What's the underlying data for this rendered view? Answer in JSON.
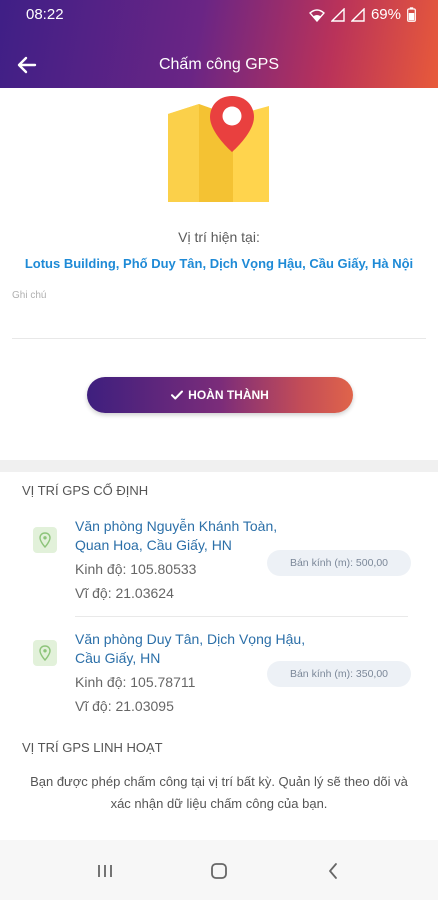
{
  "status_bar": {
    "time": "08:22",
    "battery": "69%"
  },
  "header": {
    "title": "Chấm công GPS"
  },
  "location": {
    "label": "Vị trí hiện tại:",
    "address": "Lotus Building, Phố Duy Tân, Dịch Vọng Hậu, Cầu Giấy, Hà Nội"
  },
  "note": {
    "placeholder": "Ghi chú"
  },
  "complete_button": {
    "label": "HOÀN THÀNH"
  },
  "fixed_section": {
    "title": "VỊ TRÍ GPS CỐ ĐỊNH",
    "items": [
      {
        "name": "Văn phòng Nguyễn Khánh Toàn, Quan Hoa, Cầu Giấy, HN",
        "longitude": "Kinh độ: 105.80533",
        "latitude": "Vĩ độ: 21.03624",
        "radius": "Bán kính (m): 500,00"
      },
      {
        "name": "Văn phòng Duy Tân, Dịch Vọng Hậu, Cầu Giấy, HN",
        "longitude": "Kinh độ: 105.78711",
        "latitude": "Vĩ độ: 21.03095",
        "radius": "Bán kính (m): 350,00"
      }
    ]
  },
  "flexible_section": {
    "title": "VỊ TRÍ GPS LINH HOẠT",
    "description": "Bạn được phép chấm công tại vị trí bất kỳ. Quản lý sẽ theo dõi và xác nhận dữ liệu chấm công của bạn."
  },
  "colors": {
    "accent_blue": "#1e8ad6",
    "header_gradient_start": "#3f1f86",
    "header_gradient_end": "#e85a3a"
  },
  "icons": [
    "wifi-icon",
    "signal-icon",
    "battery-icon",
    "back-arrow-icon",
    "map-pin-illustration",
    "check-icon",
    "location-pin-icon",
    "recent-apps-icon",
    "home-icon",
    "nav-back-icon"
  ]
}
